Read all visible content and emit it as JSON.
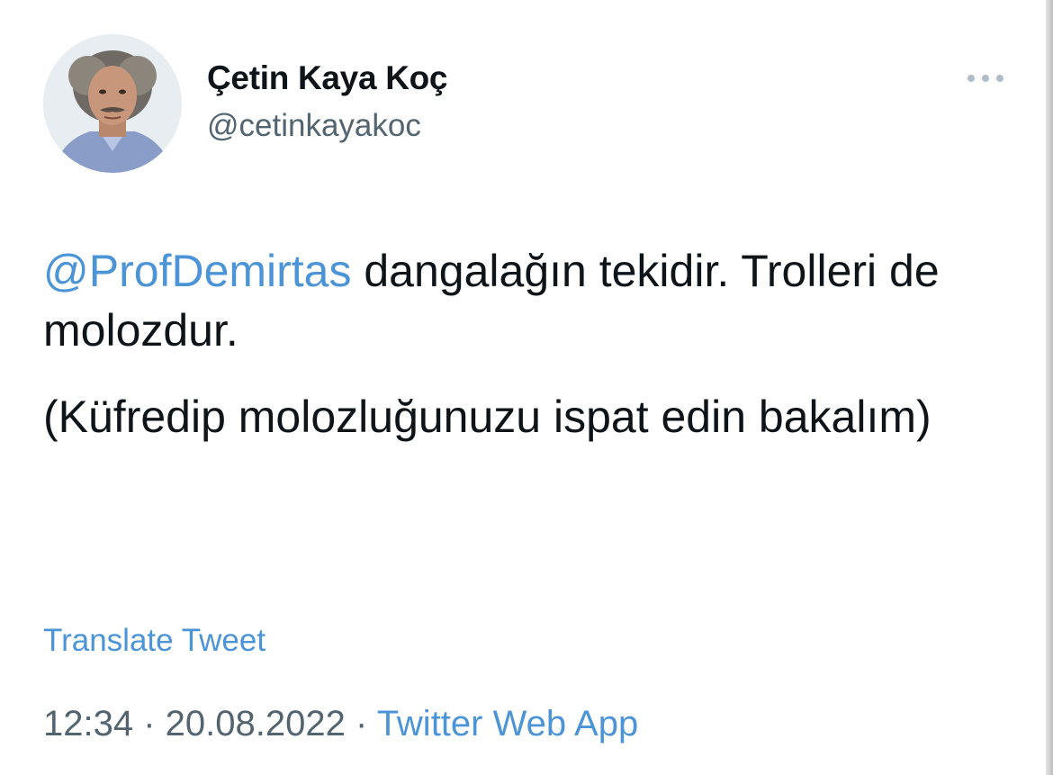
{
  "author": {
    "display_name": "Çetin Kaya Koç",
    "handle": "@cetinkayakoc"
  },
  "more_button": {
    "icon": "more-horizontal-icon"
  },
  "tweet": {
    "mention": "@ProfDemirtas",
    "line1_rest": " dangalağın tekidir. Trolleri de molozdur.",
    "line2": "(Küfredip molozluğunuzu ispat edin bakalım)"
  },
  "translate_label": "Translate Tweet",
  "meta": {
    "time": "12:34",
    "separator1": " · ",
    "date": "20.08.2022",
    "separator2": " · ",
    "source": "Twitter Web App"
  },
  "colors": {
    "link": "#4c94d8",
    "text": "#0f1419",
    "secondary": "#536471"
  }
}
